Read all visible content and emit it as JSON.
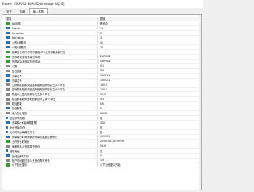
{
  "window": {
    "title": "Expert - GBPUSD EURUSD Arbitrage SA[H1]"
  },
  "tabs": [
    "关于",
    "依赖",
    "输入参数"
  ],
  "header": {
    "var": "变量",
    "val": "数值"
  },
  "rows": [
    {
      "name": "EA标题",
      "value": "跨品种",
      "icon": "g"
    },
    {
      "name": "Depth",
      "value": "12",
      "icon": "b"
    },
    {
      "name": "Deviation",
      "value": "5",
      "icon": "b"
    },
    {
      "name": "Backstep",
      "value": "3",
      "icon": "b"
    },
    {
      "name": "大的K线数量",
      "value": "50",
      "icon": "b"
    },
    {
      "name": "小的K线数量",
      "value": "20",
      "icon": "b"
    },
    {
      "name": "锁单仓位均开仓时时使用MT4上的手数增减开仓",
      "value": "",
      "icon": "g"
    },
    {
      "name": "货币对1(手数有减货币对)",
      "value": "EURUSD",
      "icon": "g"
    },
    {
      "name": "货币对2(手数增加货币对)",
      "value": "GBPUSD",
      "icon": "g"
    },
    {
      "name": "手数",
      "value": "0.1",
      "icon": "n"
    },
    {
      "name": "加仓倍数",
      "value": "3.0",
      "icon": "n"
    },
    {
      "name": "多单订号",
      "value": "100011",
      "icon": "b"
    },
    {
      "name": "空单订号",
      "value": "100021",
      "icon": "b"
    },
    {
      "name": "止损额在趋势开始盈利趋势回调百分之多少平仓",
      "value": "100.0",
      "icon": "n"
    },
    {
      "name": "盈利额在趋势开始盈利趋势回调百分之多少平仓",
      "value": "100.0",
      "icon": "n"
    },
    {
      "name": "额度以上盈利回调百分之多少平仓",
      "value": "50.0",
      "icon": "n"
    },
    {
      "name": "附加参数趋势盈利回调百分之多少平仓",
      "value": "0.3",
      "icon": "n"
    },
    {
      "name": "附加参数",
      "value": "0.0",
      "icon": "n"
    },
    {
      "name": "加仓参数",
      "value": "5",
      "icon": "b"
    },
    {
      "name": "最大加仓倍数",
      "value": "0.005",
      "icon": "n"
    },
    {
      "name": "是否关闭倍数",
      "value": "是",
      "icon": "t"
    },
    {
      "name": "开单最小K线间隔数根",
      "value": "300",
      "icon": "b"
    },
    {
      "name": "允许开始加仓",
      "value": "是",
      "icon": "t"
    },
    {
      "name": "允许时间点每周次开仓",
      "value": "是",
      "icon": "t"
    },
    {
      "name": "开单最小时间间隔小开单次数超过就停止",
      "value": "999999",
      "icon": "b"
    },
    {
      "name": "允许开仓时间段",
      "value": "23:00:00-23:59:59",
      "icon": "g"
    },
    {
      "name": "偏差值多少倍数暂停开仓",
      "value": "50.0",
      "icon": "n"
    },
    {
      "name": "超时地址",
      "value": "否",
      "icon": "t"
    },
    {
      "name": "启动后超时时间",
      "value": "5",
      "icon": "b"
    },
    {
      "name": "账户时间超过多少天开仓再可开仓",
      "value": "1.0",
      "icon": "n"
    },
    {
      "name": "以下加仓提示",
      "value": "以下加仓提示开始",
      "icon": "g"
    }
  ]
}
